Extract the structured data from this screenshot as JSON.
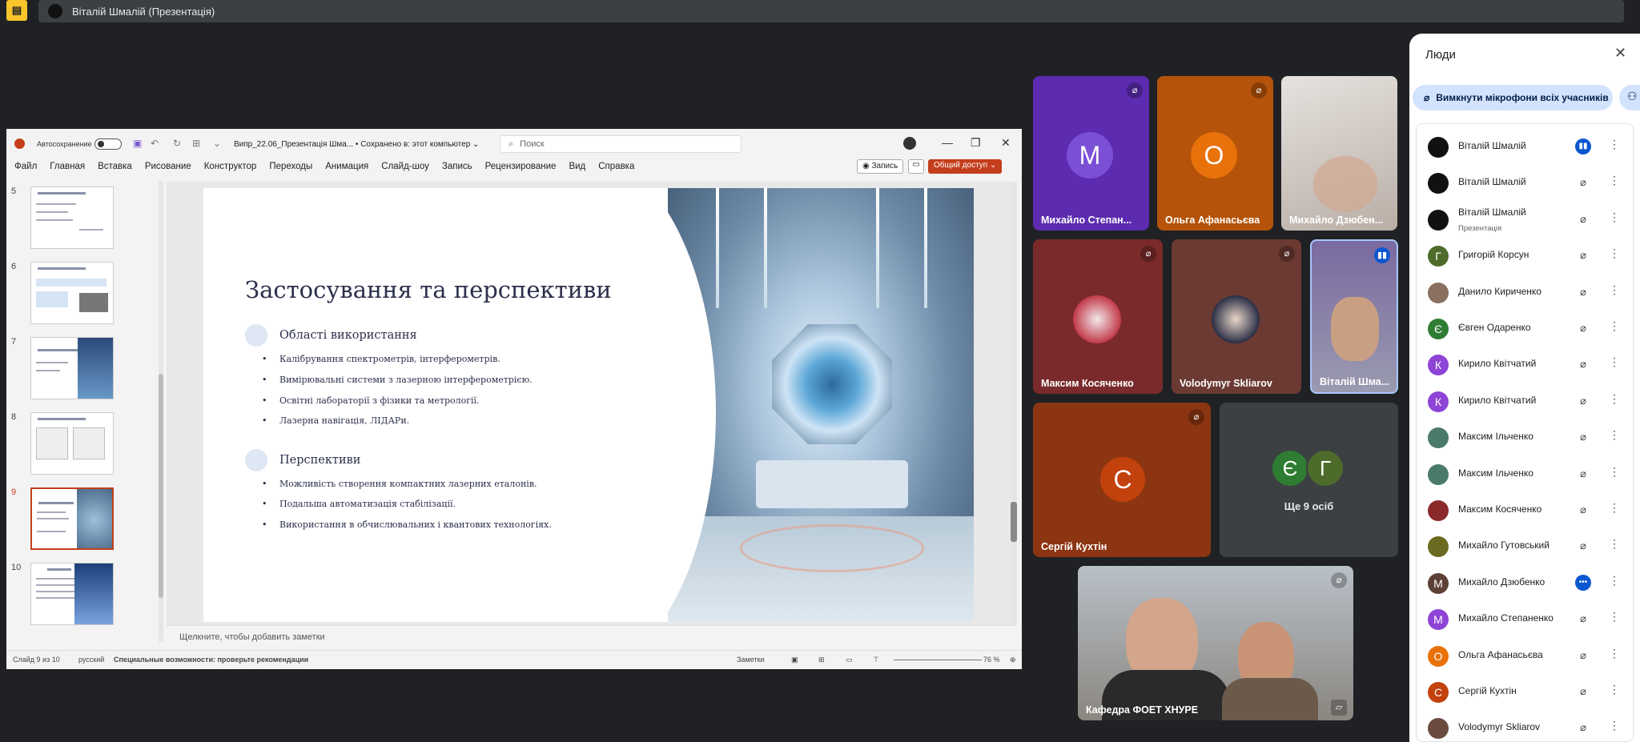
{
  "meet": {
    "presenter_chip": "Віталій Шмалій (Презентація)",
    "present_icon": "presentation-off-icon"
  },
  "ppt": {
    "autosave_label": "Автосохранение",
    "doc_title": "Випр_22.06_Презентація Шма... • Сохранено в: этот компьютер ⌄",
    "search_placeholder": "Поиск",
    "menu": [
      "Файл",
      "Главная",
      "Вставка",
      "Рисование",
      "Конструктор",
      "Переходы",
      "Анимация",
      "Слайд-шоу",
      "Запись",
      "Рецензирование",
      "Вид",
      "Справка"
    ],
    "record_label": "◉ Запись",
    "share_label": "Общий доступ ⌄",
    "thumbnails": [
      {
        "num": "5"
      },
      {
        "num": "6"
      },
      {
        "num": "7"
      },
      {
        "num": "8"
      },
      {
        "num": "9"
      },
      {
        "num": "10"
      }
    ],
    "notes_placeholder": "Щелкните, чтобы добавить заметки",
    "status": {
      "slide": "Слайд 9 из 10",
      "lang": "русский",
      "accessibility": "Специальные возможности: проверьте рекомендации",
      "notes": "Заметки",
      "zoom": "76 %"
    }
  },
  "slide": {
    "title": "Застосування та перспективи",
    "sections": [
      {
        "title": "Області використання",
        "bullets": [
          "Калібрування спектрометрів, інтерферометрів.",
          "Вимірювальні системи з лазерною інтерферометрією.",
          "Освітні лабораторії з фізики та метрології.",
          "Лазерна навігація, ЛІДАРи."
        ]
      },
      {
        "title": "Перспективи",
        "bullets": [
          "Можливість створення компактних лазерних еталонів.",
          "Подальша автоматизація стабілізації.",
          "Використання в обчислювальних і квантових технологіях."
        ]
      }
    ]
  },
  "tiles": [
    {
      "name": "Михайло Степан...",
      "initial": "M",
      "bg": "#5c2bb0",
      "avbg": "#7b4fd6"
    },
    {
      "name": "Ольга Афанасьєва",
      "initial": "O",
      "bg": "#b45309",
      "avbg": "#e8710a"
    },
    {
      "name": "Михайло Дзюбен..."
    },
    {
      "name": "Максим Косяченко",
      "bg": "#7a2a2a"
    },
    {
      "name": "Volodymyr Skliarov",
      "bg": "#6b3a33"
    },
    {
      "name": "Віталій Шма..."
    },
    {
      "name": "Сергій Кухтін",
      "initial": "С",
      "bg": "#8c3512",
      "avbg": "#c2410c"
    },
    {
      "name": "Ще 9 осіб",
      "initials": [
        "Є",
        "Г"
      ]
    },
    {
      "name": "Кафедра ФОЕТ ХНУРЕ"
    }
  ],
  "people_panel": {
    "title": "Люди",
    "mute_all": "Вимкнути мікрофони всіх учасників",
    "people": [
      {
        "name": "Віталій Шмалій",
        "sub": "",
        "initial": "",
        "color": "#111111",
        "mic": "active"
      },
      {
        "name": "Віталій Шмалій",
        "sub": "",
        "initial": "",
        "color": "#111111",
        "mic": "muted"
      },
      {
        "name": "Віталій Шмалій",
        "sub": "Презентація",
        "initial": "",
        "color": "#111111",
        "mic": "off"
      },
      {
        "name": "Григорій Корсун",
        "sub": "",
        "initial": "Г",
        "color": "#4d6b2a",
        "mic": "muted"
      },
      {
        "name": "Данило Кириченко",
        "sub": "",
        "initial": "",
        "color": "#8a7060",
        "mic": "muted"
      },
      {
        "name": "Євген Одаренко",
        "sub": "",
        "initial": "Є",
        "color": "#2e7d32",
        "mic": "muted"
      },
      {
        "name": "Кирило Квітчатий",
        "sub": "",
        "initial": "К",
        "color": "#8e44d6",
        "mic": "muted"
      },
      {
        "name": "Кирило Квітчатий",
        "sub": "",
        "initial": "К",
        "color": "#8e44d6",
        "mic": "muted"
      },
      {
        "name": "Максим Ільченко",
        "sub": "",
        "initial": "",
        "color": "#4a7a6a",
        "mic": "muted"
      },
      {
        "name": "Максим Ільченко",
        "sub": "",
        "initial": "",
        "color": "#4a7a6a",
        "mic": "muted"
      },
      {
        "name": "Максим Косяченко",
        "sub": "",
        "initial": "",
        "color": "#8a2a2a",
        "mic": "muted"
      },
      {
        "name": "Михайло Гутовський",
        "sub": "",
        "initial": "",
        "color": "#6a6a20",
        "mic": "muted"
      },
      {
        "name": "Михайло Дзюбенко",
        "sub": "",
        "initial": "M",
        "color": "#5d4037",
        "mic": "more"
      },
      {
        "name": "Михайло Степаненко",
        "sub": "",
        "initial": "M",
        "color": "#8e44d6",
        "mic": "muted"
      },
      {
        "name": "Ольга Афанасьєва",
        "sub": "",
        "initial": "O",
        "color": "#e8710a",
        "mic": "muted"
      },
      {
        "name": "Сергій Кухтін",
        "sub": "",
        "initial": "C",
        "color": "#c2410c",
        "mic": "muted"
      },
      {
        "name": "Volodymyr Skliarov",
        "sub": "",
        "initial": "",
        "color": "#6b4a40",
        "mic": "muted"
      }
    ]
  }
}
